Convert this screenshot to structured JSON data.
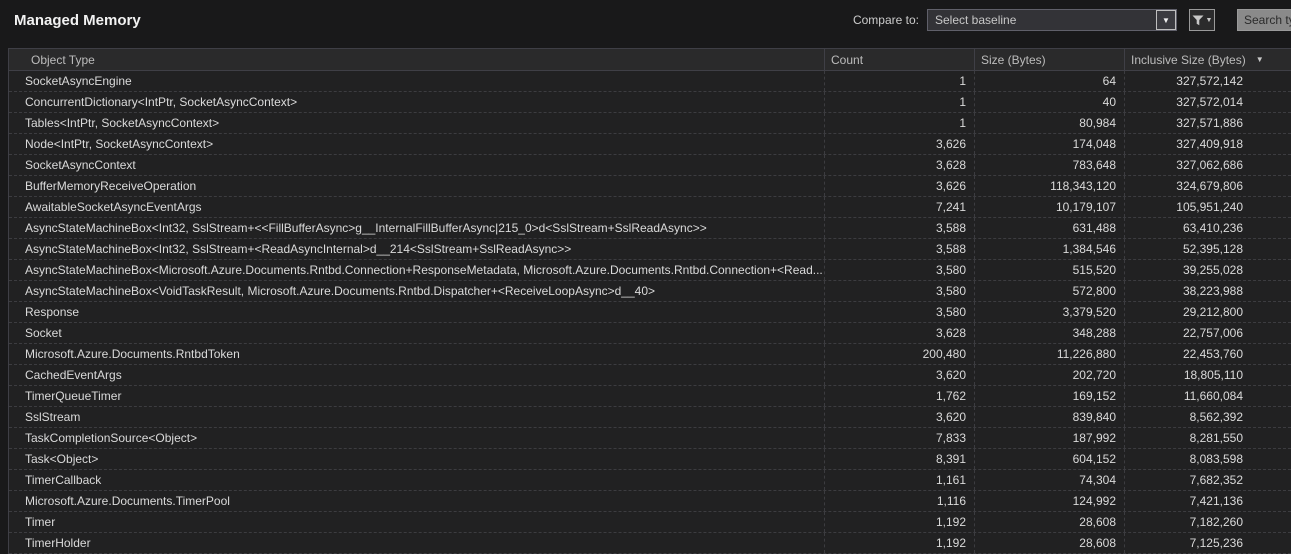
{
  "toolbar": {
    "title": "Managed Memory",
    "compare_label": "Compare to:",
    "baseline_placeholder": "Select baseline",
    "search_placeholder": "Search type"
  },
  "icons": {
    "baseline_dropdown_chevron": "▼",
    "filter_caret": "▼",
    "sort_descending": "▼"
  },
  "colors": {
    "background": "#19191a",
    "row_background": "#212122",
    "header_background": "#2a2a2b",
    "grid_line": "#3c3c40",
    "text": "#dadada"
  },
  "table": {
    "columns": [
      "Object Type",
      "Count",
      "Size (Bytes)",
      "Inclusive Size (Bytes)"
    ],
    "sort": {
      "column": "Inclusive Size (Bytes)",
      "direction": "descending"
    },
    "rows": [
      {
        "type": "SocketAsyncEngine",
        "count": "1",
        "size": "64",
        "inclusive": "327,572,142"
      },
      {
        "type": "ConcurrentDictionary<IntPtr, SocketAsyncContext>",
        "count": "1",
        "size": "40",
        "inclusive": "327,572,014"
      },
      {
        "type": "Tables<IntPtr, SocketAsyncContext>",
        "count": "1",
        "size": "80,984",
        "inclusive": "327,571,886"
      },
      {
        "type": "Node<IntPtr, SocketAsyncContext>",
        "count": "3,626",
        "size": "174,048",
        "inclusive": "327,409,918"
      },
      {
        "type": "SocketAsyncContext",
        "count": "3,628",
        "size": "783,648",
        "inclusive": "327,062,686"
      },
      {
        "type": "BufferMemoryReceiveOperation",
        "count": "3,626",
        "size": "118,343,120",
        "inclusive": "324,679,806"
      },
      {
        "type": "AwaitableSocketAsyncEventArgs",
        "count": "7,241",
        "size": "10,179,107",
        "inclusive": "105,951,240"
      },
      {
        "type": "AsyncStateMachineBox<Int32, SslStream+<<FillBufferAsync>g__InternalFillBufferAsync|215_0>d<SslStream+SslReadAsync>>",
        "count": "3,588",
        "size": "631,488",
        "inclusive": "63,410,236"
      },
      {
        "type": "AsyncStateMachineBox<Int32, SslStream+<ReadAsyncInternal>d__214<SslStream+SslReadAsync>>",
        "count": "3,588",
        "size": "1,384,546",
        "inclusive": "52,395,128"
      },
      {
        "type": "AsyncStateMachineBox<Microsoft.Azure.Documents.Rntbd.Connection+ResponseMetadata, Microsoft.Azure.Documents.Rntbd.Connection+<Read...",
        "count": "3,580",
        "size": "515,520",
        "inclusive": "39,255,028"
      },
      {
        "type": "AsyncStateMachineBox<VoidTaskResult, Microsoft.Azure.Documents.Rntbd.Dispatcher+<ReceiveLoopAsync>d__40>",
        "count": "3,580",
        "size": "572,800",
        "inclusive": "38,223,988"
      },
      {
        "type": "Response",
        "count": "3,580",
        "size": "3,379,520",
        "inclusive": "29,212,800"
      },
      {
        "type": "Socket",
        "count": "3,628",
        "size": "348,288",
        "inclusive": "22,757,006"
      },
      {
        "type": "Microsoft.Azure.Documents.RntbdToken",
        "count": "200,480",
        "size": "11,226,880",
        "inclusive": "22,453,760"
      },
      {
        "type": "CachedEventArgs",
        "count": "3,620",
        "size": "202,720",
        "inclusive": "18,805,110"
      },
      {
        "type": "TimerQueueTimer",
        "count": "1,762",
        "size": "169,152",
        "inclusive": "11,660,084"
      },
      {
        "type": "SslStream",
        "count": "3,620",
        "size": "839,840",
        "inclusive": "8,562,392"
      },
      {
        "type": "TaskCompletionSource<Object>",
        "count": "7,833",
        "size": "187,992",
        "inclusive": "8,281,550"
      },
      {
        "type": "Task<Object>",
        "count": "8,391",
        "size": "604,152",
        "inclusive": "8,083,598"
      },
      {
        "type": "TimerCallback",
        "count": "1,161",
        "size": "74,304",
        "inclusive": "7,682,352"
      },
      {
        "type": "Microsoft.Azure.Documents.TimerPool",
        "count": "1,116",
        "size": "124,992",
        "inclusive": "7,421,136"
      },
      {
        "type": "Timer",
        "count": "1,192",
        "size": "28,608",
        "inclusive": "7,182,260"
      },
      {
        "type": "TimerHolder",
        "count": "1,192",
        "size": "28,608",
        "inclusive": "7,125,236"
      }
    ]
  }
}
